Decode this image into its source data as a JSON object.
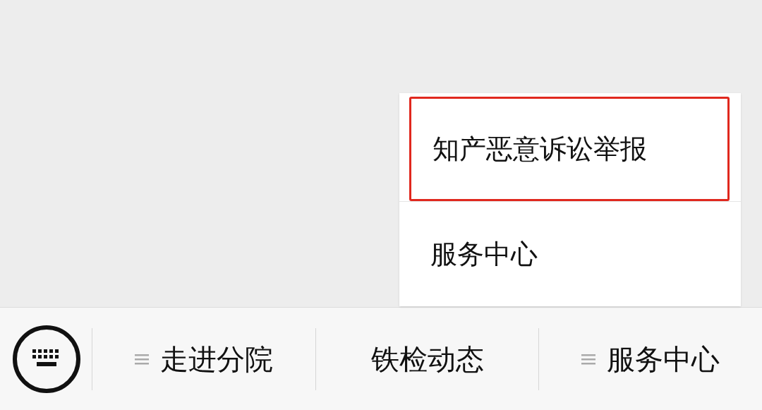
{
  "popup_menu": {
    "items": [
      {
        "label": "知产恶意诉讼举报",
        "highlighted": true
      },
      {
        "label": "服务中心",
        "highlighted": false
      }
    ]
  },
  "menu_bar": {
    "items": [
      {
        "label": "走进分院",
        "has_submenu": true
      },
      {
        "label": "铁检动态",
        "has_submenu": false
      },
      {
        "label": "服务中心",
        "has_submenu": true
      }
    ]
  }
}
